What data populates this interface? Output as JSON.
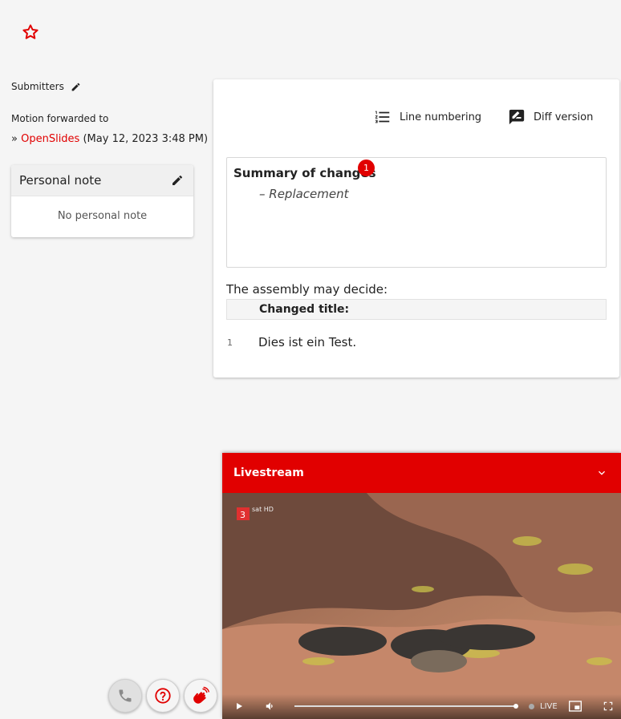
{
  "header": {
    "favorite_icon": "star-outline-icon"
  },
  "sidebar": {
    "submitters_label": "Submitters",
    "forwarded_label": "Motion forwarded to",
    "forwarded_prefix": "»",
    "forwarded_link": "OpenSlides",
    "forwarded_date": "(May 12, 2023 3:48 PM)"
  },
  "personal_note": {
    "title": "Personal note",
    "empty_text": "No personal note"
  },
  "motion": {
    "toolbar": {
      "line_numbering_label": "Line numbering",
      "diff_version_label": "Diff version"
    },
    "summary": {
      "title": "Summary of changes",
      "badge": "1",
      "item": "– Replacement"
    },
    "preamble": "The assembly may decide:",
    "changed_title": "Changed title:",
    "lines": [
      {
        "number": "1",
        "text": "Dies ist ein Test."
      }
    ]
  },
  "livestream": {
    "title": "Livestream",
    "live_label": "LIVE",
    "channel_logo": "3sat HD"
  },
  "colors": {
    "accent": "#e10000",
    "background": "#f5f5f5",
    "card": "#ffffff"
  }
}
